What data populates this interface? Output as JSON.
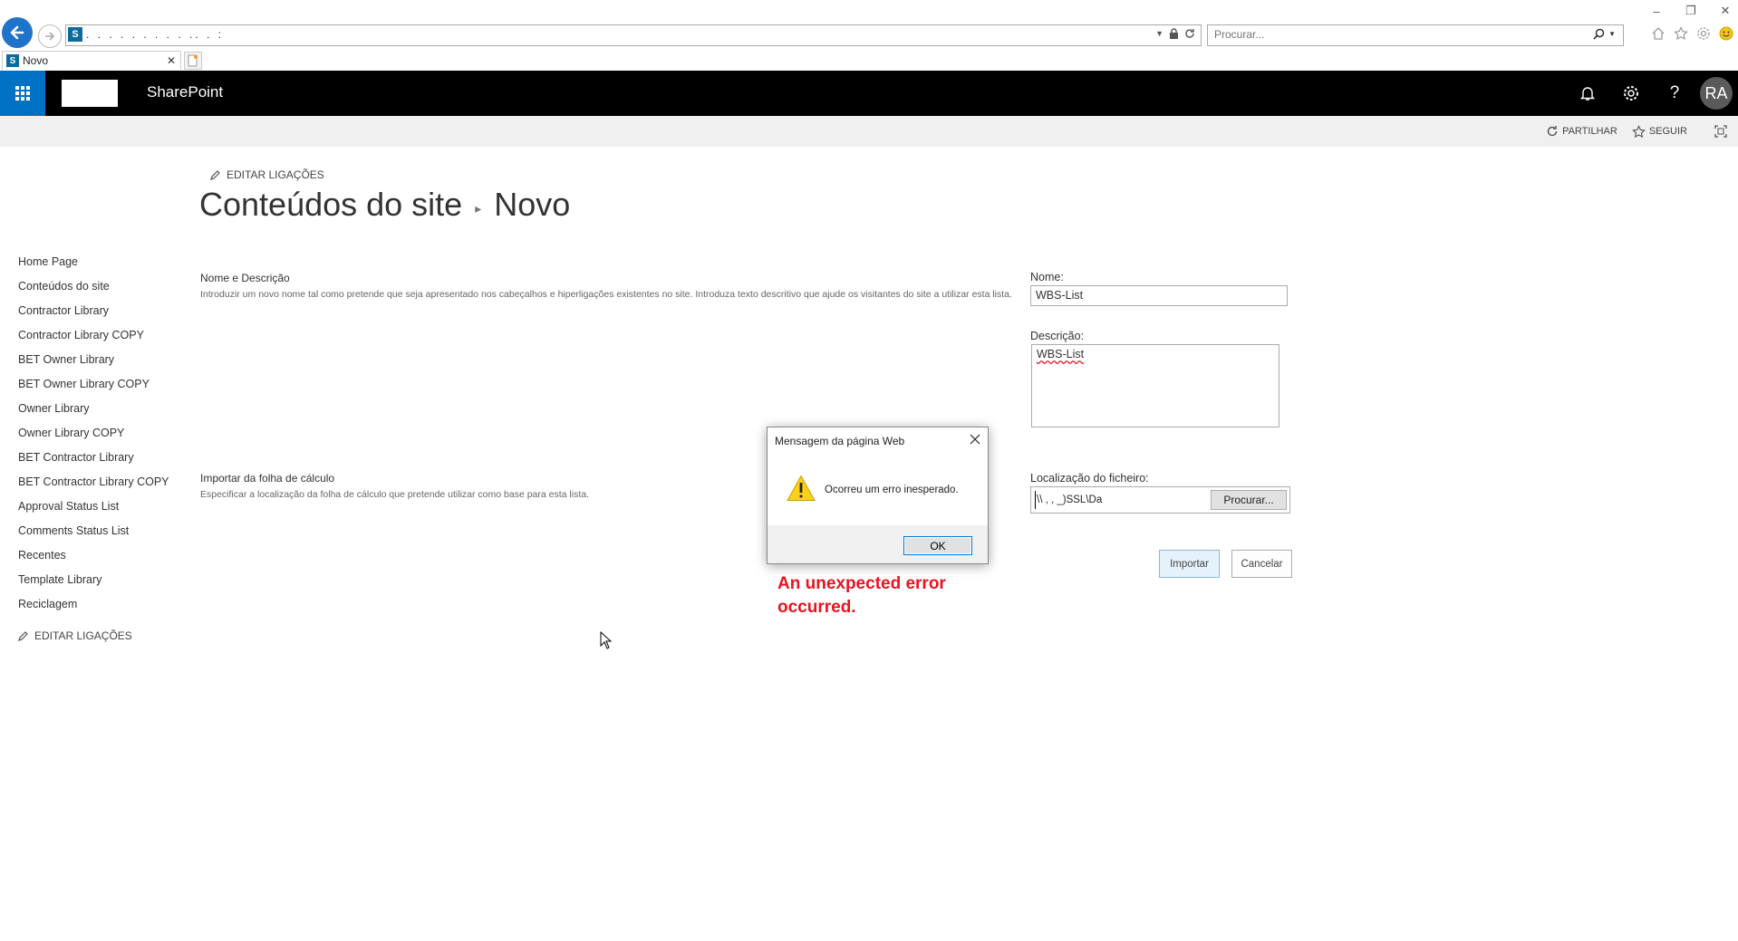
{
  "browser": {
    "address_text": ".   .       .         . .            .          .          .        .       ..        .              :",
    "search_placeholder": "Procurar...",
    "tab_title": "Novo",
    "tab_close": "✕"
  },
  "suite": {
    "brand": "SharePoint",
    "avatar_initials": "RA",
    "accent_color": "#0072c6"
  },
  "ribbon": {
    "share_label": "PARTILHAR",
    "follow_label": "SEGUIR"
  },
  "page": {
    "edit_links_label": "EDITAR LIGAÇÕES",
    "breadcrumb_parent": "Conteúdos do site",
    "breadcrumb_current": "Novo"
  },
  "leftnav": {
    "items": [
      {
        "label": "Home Page"
      },
      {
        "label": "Conteúdos do site"
      },
      {
        "label": "Contractor Library"
      },
      {
        "label": "Contractor Library COPY"
      },
      {
        "label": "BET Owner Library"
      },
      {
        "label": "BET Owner Library COPY"
      },
      {
        "label": "Owner Library"
      },
      {
        "label": "Owner Library COPY"
      },
      {
        "label": "BET Contractor Library"
      },
      {
        "label": "BET Contractor Library COPY"
      },
      {
        "label": "Approval Status List"
      },
      {
        "label": "Comments Status List"
      },
      {
        "label": "Recentes"
      },
      {
        "label": "Template Library"
      },
      {
        "label": "Reciclagem"
      }
    ],
    "edit_links_label": "EDITAR LIGAÇÕES"
  },
  "form": {
    "name_section": {
      "title": "Nome e Descrição",
      "description": "Introduzir um novo nome tal como pretende que seja apresentado nos cabeçalhos e hiperligações existentes no site. Introduza texto descritivo que ajude os visitantes do site a utilizar esta lista."
    },
    "import_section": {
      "title": "Importar da folha de cálculo",
      "description": "Especificar a localização da folha de cálculo que pretende utilizar como base para esta lista."
    },
    "name_label": "Nome:",
    "name_value": "WBS-List",
    "description_label": "Descrição:",
    "description_value": "WBS-List",
    "file_location_label": "Localização do ficheiro:",
    "file_location_value": "\\\\ ,           ,          _)SSL\\Da",
    "browse_label": "Procurar...",
    "import_label": "Importar",
    "cancel_label": "Cancelar"
  },
  "dialog": {
    "title": "Mensagem da página Web",
    "message": "Ocorreu um erro inesperado.",
    "ok_label": "OK",
    "icon": "warning-icon"
  },
  "annotation": {
    "text": "An unexpected error occurred.",
    "color": "#e8141f"
  }
}
